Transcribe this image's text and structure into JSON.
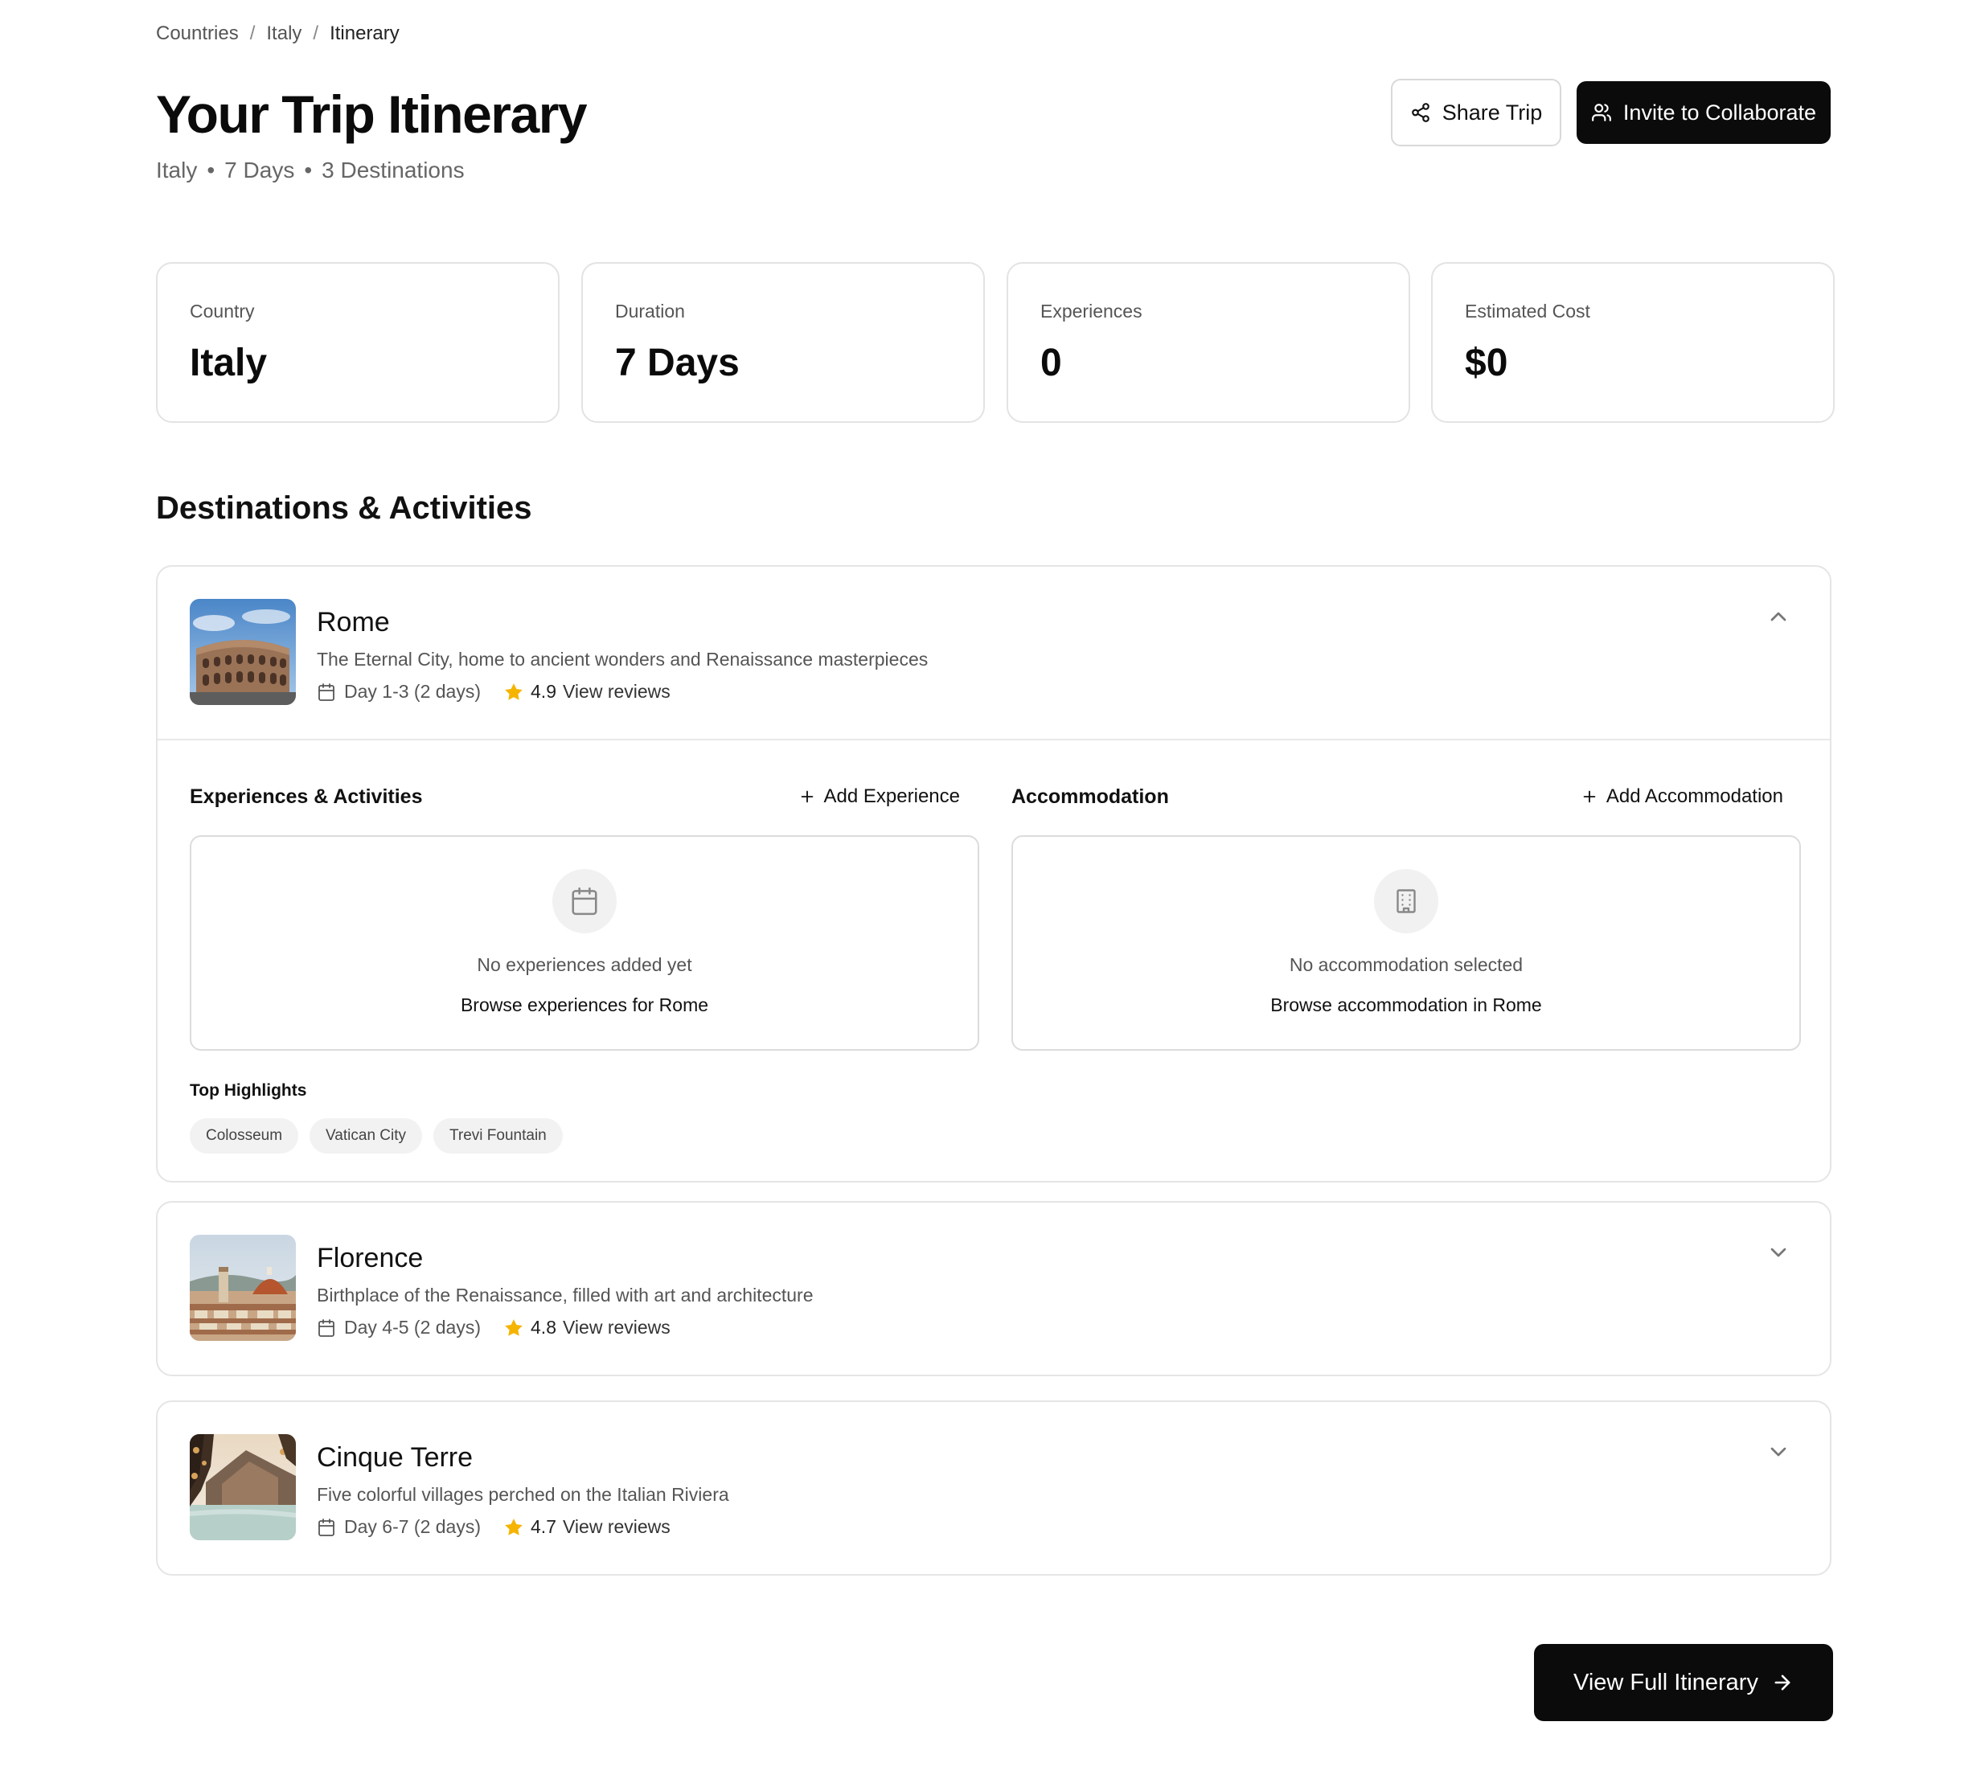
{
  "breadcrumb": {
    "items": [
      "Countries",
      "Italy",
      "Itinerary"
    ],
    "separator": "/"
  },
  "header": {
    "title": "Your Trip Itinerary",
    "subtitle": {
      "country": "Italy",
      "days": "7 Days",
      "destinations": "3 Destinations",
      "dot": "•"
    },
    "share_label": "Share Trip",
    "invite_label": "Invite to Collaborate"
  },
  "stats": [
    {
      "label": "Country",
      "value": "Italy"
    },
    {
      "label": "Duration",
      "value": "7 Days"
    },
    {
      "label": "Experiences",
      "value": "0"
    },
    {
      "label": "Estimated Cost",
      "value": "$0"
    }
  ],
  "section_title": "Destinations & Activities",
  "destinations": [
    {
      "name": "Rome",
      "description": "The Eternal City, home to ancient wonders and Renaissance masterpieces",
      "days": "Day 1-3 (2 days)",
      "rating": "4.9",
      "reviews_label": "View reviews",
      "expanded": true,
      "experiences_title": "Experiences & Activities",
      "add_experience": "Add Experience",
      "accommodation_title": "Accommodation",
      "add_accommodation": "Add Accommodation",
      "no_experiences": "No experiences added yet",
      "browse_experiences": "Browse experiences for Rome",
      "no_accommodation": "No accommodation selected",
      "browse_accommodation": "Browse accommodation in Rome",
      "highlights_title": "Top Highlights",
      "highlights": [
        "Colosseum",
        "Vatican City",
        "Trevi Fountain"
      ]
    },
    {
      "name": "Florence",
      "description": "Birthplace of the Renaissance, filled with art and architecture",
      "days": "Day 4-5 (2 days)",
      "rating": "4.8",
      "reviews_label": "View reviews",
      "expanded": false
    },
    {
      "name": "Cinque Terre",
      "description": "Five colorful villages perched on the Italian Riviera",
      "days": "Day 6-7 (2 days)",
      "rating": "4.7",
      "reviews_label": "View reviews",
      "expanded": false
    }
  ],
  "view_full_label": "View Full Itinerary",
  "colors": {
    "primary": "#0b0b0b",
    "star": "#f5b400",
    "border": "#e5e5e5",
    "muted_text": "#555555"
  },
  "icons": [
    "share-icon",
    "users-icon",
    "calendar-icon",
    "star-icon",
    "chevron-up-icon",
    "chevron-down-icon",
    "plus-icon",
    "building-icon",
    "arrow-right-icon"
  ]
}
